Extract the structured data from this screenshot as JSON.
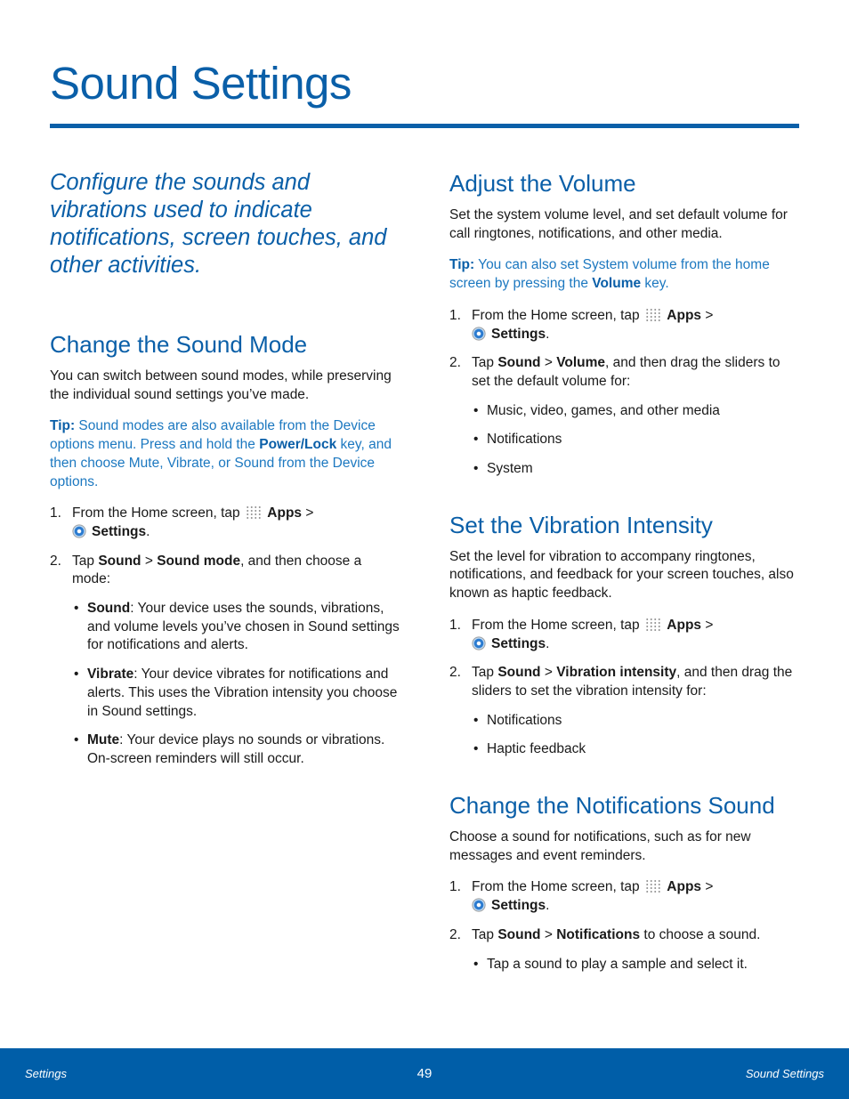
{
  "page": {
    "title": "Sound Settings",
    "intro": "Configure the sounds and vibrations used to indicate notifications, screen touches, and other activities."
  },
  "left": {
    "section1": {
      "heading": "Change the Sound Mode",
      "para": "You can switch between sound modes, while preserving the individual sound settings you’ve made.",
      "tip_label": "Tip:",
      "tip_text1": " Sound modes are also available from the Device options menu. Press and hold the ",
      "tip_bold": "Power/Lock",
      "tip_text2": " key, and then choose Mute, Vibrate, or Sound from the Device options.",
      "step1": {
        "num": "1.",
        "pre": "From the Home screen, tap ",
        "apps": "Apps",
        "gt": " >",
        "settings": "Settings",
        "end": "."
      },
      "step2": {
        "num": "2.",
        "pre": "Tap ",
        "b1": "Sound",
        "mid": " > ",
        "b2": "Sound mode",
        "post": ", and then choose a mode:"
      },
      "bullets": [
        {
          "term": "Sound",
          "text": ": Your device uses the sounds, vibrations, and volume levels you’ve chosen in Sound settings for notifications and alerts."
        },
        {
          "term": "Vibrate",
          "text": ": Your device vibrates for notifications and alerts. This uses the Vibration intensity you choose in Sound settings."
        },
        {
          "term": "Mute",
          "text": ": Your device plays no sounds or vibrations. On-screen reminders will still occur."
        }
      ]
    }
  },
  "right": {
    "volume": {
      "heading": "Adjust the Volume",
      "para": "Set the system volume level, and set default volume for call ringtones, notifications, and other media.",
      "tip_label": "Tip:",
      "tip_text1": " You can also set System volume from the home screen by pressing the ",
      "tip_bold": "Volume",
      "tip_text2": " key.",
      "step1": {
        "num": "1.",
        "pre": "From the Home screen, tap ",
        "apps": "Apps",
        "gt": " >",
        "settings": "Settings",
        "end": "."
      },
      "step2": {
        "num": "2.",
        "pre": "Tap ",
        "b1": "Sound",
        "mid": " > ",
        "b2": "Volume",
        "post": ", and then drag the sliders to set the default volume for:"
      },
      "bullets": [
        "Music, video, games, and other media",
        "Notifications",
        "System"
      ]
    },
    "vibration": {
      "heading": "Set the Vibration Intensity",
      "para": "Set the level for vibration to accompany ringtones, notifications, and feedback for your screen touches, also known as haptic feedback.",
      "step1": {
        "num": "1.",
        "pre": "From the Home screen, tap ",
        "apps": "Apps",
        "gt": " >",
        "settings": "Settings",
        "end": "."
      },
      "step2": {
        "num": "2.",
        "pre": "Tap ",
        "b1": "Sound",
        "mid": " > ",
        "b2": "Vibration intensity",
        "post": ", and then drag the sliders to set the vibration intensity for:"
      },
      "bullets": [
        "Notifications",
        "Haptic feedback"
      ]
    },
    "notifications": {
      "heading": "Change the Notifications Sound",
      "para": "Choose a sound for notifications, such as for new messages and event reminders.",
      "step1": {
        "num": "1.",
        "pre": "From the Home screen, tap ",
        "apps": "Apps",
        "gt": " >",
        "settings": "Settings",
        "end": "."
      },
      "step2": {
        "num": "2.",
        "pre": "Tap ",
        "b1": "Sound",
        "mid": " > ",
        "b2": "Notifications",
        "post": " to choose a sound."
      },
      "bullets": [
        "Tap a sound to play a sample and select it."
      ]
    }
  },
  "footer": {
    "left": "Settings",
    "page": "49",
    "right": "Sound Settings"
  }
}
